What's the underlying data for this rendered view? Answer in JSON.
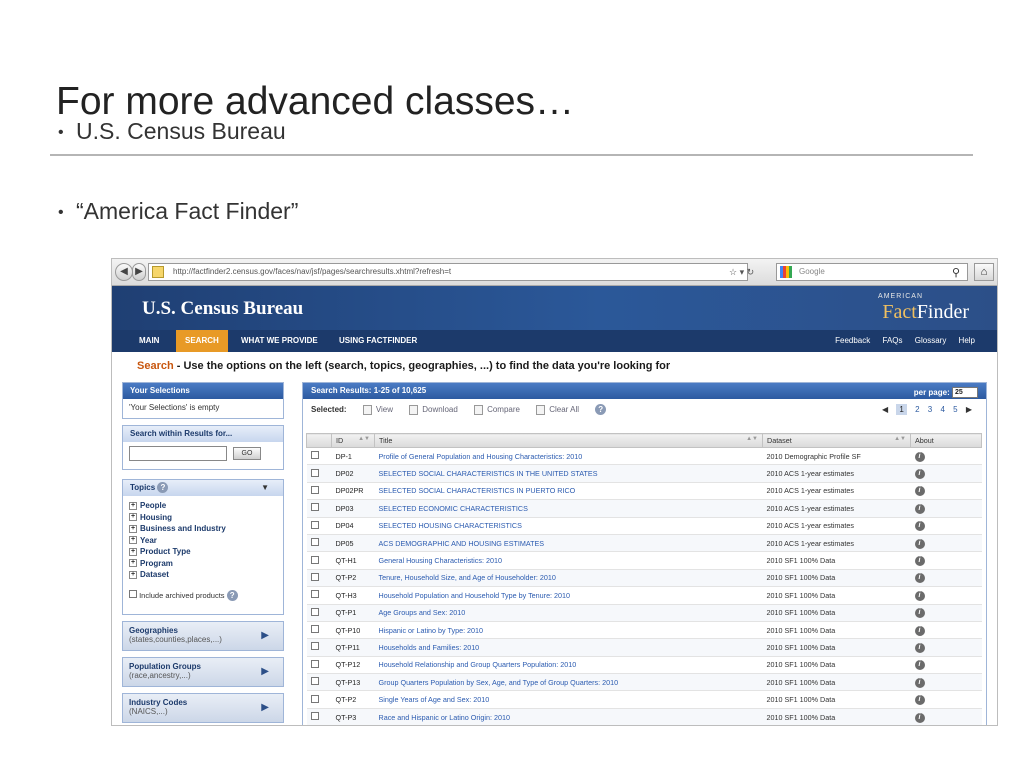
{
  "slide": {
    "title": "For more advanced classes…",
    "bullets": [
      "U.S. Census Bureau",
      "“America Fact Finder”"
    ],
    "bullet_glyph": "•"
  },
  "browser": {
    "url": "http://factfinder2.census.gov/faces/nav/jsf/pages/searchresults.xhtml?refresh=t",
    "search_placeholder": "Google"
  },
  "site": {
    "logo": "U.S. Census Bureau",
    "ff_small": "AMERICAN",
    "ff_fact": "Fact",
    "ff_finder": "Finder",
    "nav": [
      "MAIN",
      "SEARCH",
      "WHAT WE PROVIDE",
      "USING FACTFINDER"
    ],
    "util": [
      "Feedback",
      "FAQs",
      "Glossary",
      "Help"
    ]
  },
  "banner": {
    "highlight": "Search",
    "rest": " - Use the options on the left (search, topics, geographies, ...) to find the data you're looking for"
  },
  "left": {
    "selections_title": "Your Selections",
    "selections_empty": "'Your Selections' is empty",
    "search_title": "Search within Results for...",
    "go": "GO",
    "topics_title": "Topics",
    "topics": [
      "People",
      "Housing",
      "Business and Industry",
      "Year",
      "Product Type",
      "Program",
      "Dataset"
    ],
    "archived": "Include archived products",
    "geographies": {
      "title": "Geographies",
      "sub": "(states,counties,places,...)"
    },
    "pop_groups": {
      "title": "Population Groups",
      "sub": "(race,ancestry,...)"
    },
    "industry": {
      "title": "Industry Codes",
      "sub": "(NAICS,...)"
    }
  },
  "results": {
    "header": "Search Results: 1-25 of 10,625",
    "per_page_label": "per page:",
    "per_page_value": "25",
    "selected_label": "Selected:",
    "actions": [
      "View",
      "Download",
      "Compare",
      "Clear All"
    ],
    "pages": [
      "1",
      "2",
      "3",
      "4",
      "5"
    ],
    "columns": [
      "ID",
      "Title",
      "Dataset",
      "About"
    ],
    "rows": [
      {
        "id": "DP-1",
        "title": "Profile of General Population and Housing Characteristics: 2010",
        "dataset": "2010 Demographic Profile SF"
      },
      {
        "id": "DP02",
        "title": "SELECTED SOCIAL CHARACTERISTICS IN THE UNITED STATES",
        "dataset": "2010 ACS 1-year estimates"
      },
      {
        "id": "DP02PR",
        "title": "SELECTED SOCIAL CHARACTERISTICS IN PUERTO RICO",
        "dataset": "2010 ACS 1-year estimates"
      },
      {
        "id": "DP03",
        "title": "SELECTED ECONOMIC CHARACTERISTICS",
        "dataset": "2010 ACS 1-year estimates"
      },
      {
        "id": "DP04",
        "title": "SELECTED HOUSING CHARACTERISTICS",
        "dataset": "2010 ACS 1-year estimates"
      },
      {
        "id": "DP05",
        "title": "ACS DEMOGRAPHIC AND HOUSING ESTIMATES",
        "dataset": "2010 ACS 1-year estimates"
      },
      {
        "id": "QT-H1",
        "title": "General Housing Characteristics: 2010",
        "dataset": "2010 SF1 100% Data"
      },
      {
        "id": "QT-P2",
        "title": "Tenure, Household Size, and Age of Householder: 2010",
        "dataset": "2010 SF1 100% Data"
      },
      {
        "id": "QT-H3",
        "title": "Household Population and Household Type by Tenure: 2010",
        "dataset": "2010 SF1 100% Data"
      },
      {
        "id": "QT-P1",
        "title": "Age Groups and Sex: 2010",
        "dataset": "2010 SF1 100% Data"
      },
      {
        "id": "QT-P10",
        "title": "Hispanic or Latino by Type: 2010",
        "dataset": "2010 SF1 100% Data"
      },
      {
        "id": "QT-P11",
        "title": "Households and Families: 2010",
        "dataset": "2010 SF1 100% Data"
      },
      {
        "id": "QT-P12",
        "title": "Household Relationship and Group Quarters Population: 2010",
        "dataset": "2010 SF1 100% Data"
      },
      {
        "id": "QT-P13",
        "title": "Group Quarters Population by Sex, Age, and Type of Group Quarters: 2010",
        "dataset": "2010 SF1 100% Data"
      },
      {
        "id": "QT-P2",
        "title": "Single Years of Age and Sex: 2010",
        "dataset": "2010 SF1 100% Data"
      },
      {
        "id": "QT-P3",
        "title": "Race and Hispanic or Latino Origin: 2010",
        "dataset": "2010 SF1 100% Data"
      }
    ]
  }
}
